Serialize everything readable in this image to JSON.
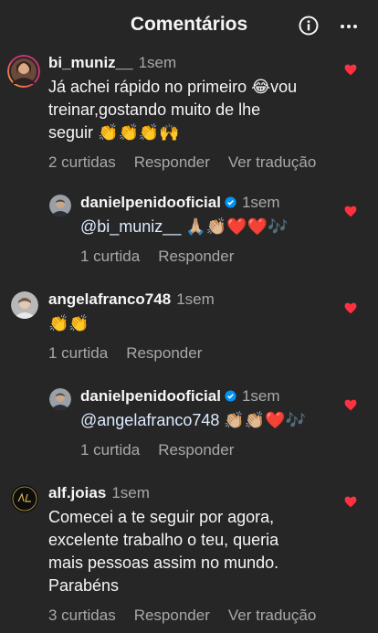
{
  "header": {
    "title": "Comentários"
  },
  "comments": [
    {
      "username": "bi_muniz__",
      "time": "1sem",
      "text_line1": "Já achei rápido no primeiro 😂vou",
      "text_line2": "treinar,gostando muito de lhe",
      "text_line3": "seguir 👏👏👏🙌",
      "likes": "2 curtidas",
      "reply": "Responder",
      "translate": "Ver tradução"
    },
    {
      "username": "danielpenidooficial",
      "time": "1sem",
      "mention": "@bi_muniz__",
      "text_rest": " 🙏🏼👏🏼❤️❤️🎶",
      "likes": "1 curtida",
      "reply": "Responder"
    },
    {
      "username": "angelafranco748",
      "time": "1sem",
      "text_line1": "👏👏",
      "likes": "1 curtida",
      "reply": "Responder"
    },
    {
      "username": "danielpenidooficial",
      "time": "1sem",
      "mention": "@angelafranco748",
      "text_rest": " 👏🏼👏🏼❤️🎶",
      "likes": "1 curtida",
      "reply": "Responder"
    },
    {
      "username": "alf.joias",
      "time": "1sem",
      "text_line1": "Comecei a te seguir por agora,",
      "text_line2": "excelente trabalho o teu, queria",
      "text_line3": "mais pessoas assim no mundo.",
      "text_line4": "Parabéns",
      "likes": "3 curtidas",
      "reply": "Responder",
      "translate": "Ver tradução"
    }
  ],
  "colors": {
    "background": "#262626",
    "secondary_text": "#a8a8a8",
    "heart": "#ff3040",
    "verified": "#0095f6"
  }
}
